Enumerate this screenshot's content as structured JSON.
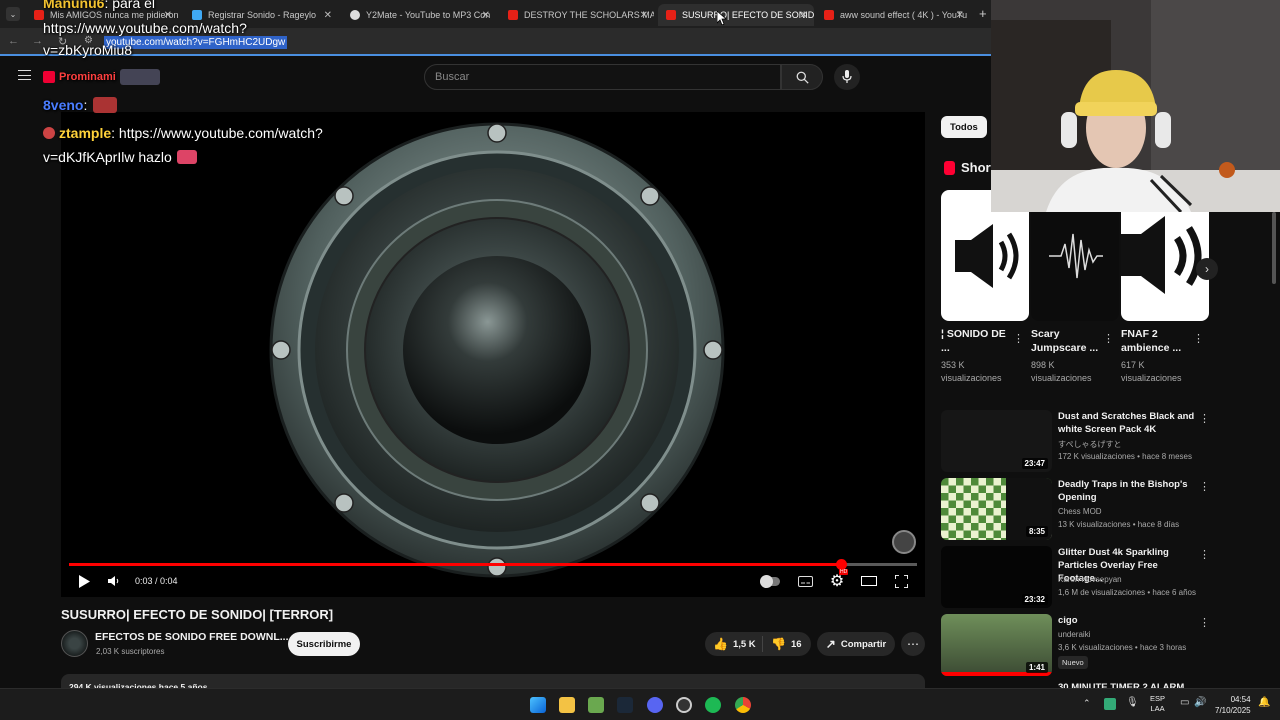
{
  "browser": {
    "tabs": [
      {
        "label": "Mis AMIGOS nunca me pidieron",
        "favicon": "#e62117",
        "active": false
      },
      {
        "label": "Registrar Sonido - Rageylo",
        "favicon": "#3fa9f5",
        "active": false
      },
      {
        "label": "Y2Mate - YouTube to MP3 Con",
        "favicon": "#dddddd",
        "active": false
      },
      {
        "label": "DESTROY THE SCHOLARS MA",
        "favicon": "#e62117",
        "active": false
      },
      {
        "label": "SUSURRO| EFECTO DE SONIDO",
        "favicon": "#e62117",
        "active": true
      },
      {
        "label": "aww sound effect ( 4K ) - YouTu",
        "favicon": "#e62117",
        "active": false
      }
    ],
    "url": "youtube.com/watch?v=FGHmHC2UDgw"
  },
  "youtube": {
    "search_placeholder": "Buscar",
    "player": {
      "time": "0:03 / 0:04",
      "progress": 0.91
    },
    "video_title": "SUSURRO| EFECTO DE SONIDO| [TERROR]",
    "channel": {
      "name": "EFECTOS DE SONIDO FREE DOWNL...",
      "subs": "2,03 K suscriptores"
    },
    "subscribe_label": "Suscribirme",
    "likes": "1,5 K",
    "dislikes": "16",
    "share_label": "Compartir",
    "description_stats": "294 K visualizaciones  hace 5 años",
    "chip_label": "Todos",
    "shorts_heading": "Shorts",
    "shorts": [
      {
        "title": "¦ SONIDO DE ...",
        "views": "353 K visualizaciones"
      },
      {
        "title": "Scary Jumpscare ...",
        "views": "898 K visualizaciones"
      },
      {
        "title": "FNAF 2 ambience ...",
        "views": "617 K visualizaciones"
      }
    ],
    "recommended": [
      {
        "title": "Dust and Scratches Black and white Screen Pack 4K",
        "channel": "すぺしゃるげすと",
        "meta": "172 K visualizaciones • hace 8 meses",
        "duration": "23:47"
      },
      {
        "title": "Deadly Traps in the Bishop's Opening",
        "channel": "Chess MOD",
        "meta": "13 K visualizaciones • hace 8 días",
        "duration": "8:35"
      },
      {
        "title": "Glitter Dust 4k Sparkling Particles Overlay Free Footage...",
        "channel": "Karen Hovsepyan",
        "meta": "1,6 M de visualizaciones • hace 6 años",
        "duration": "23:32"
      },
      {
        "title": "cigo",
        "channel": "underaiki",
        "meta": "3,6 K visualizaciones • hace 3 horas",
        "duration": "1:41",
        "badge": "Nuevo"
      }
    ],
    "rec_partial": "30 MINUTE TIMER 2 ALARM"
  },
  "chat": {
    "lines": [
      {
        "user": "Manunu6",
        "text": "para el",
        "color": "#f2c230"
      },
      {
        "user": "",
        "text": "https://www.youtube.com/watch?",
        "color": "#ffffff"
      },
      {
        "user": "",
        "text": "v=zbKyroMiu8",
        "color": "#ffffff"
      },
      {
        "user": "Prominami",
        "text": "",
        "color": "#ff4040"
      },
      {
        "user": "8veno",
        "text": ":",
        "color": "#4a7dff"
      },
      {
        "user": "ztample",
        "text": ": https://www.youtube.com/watch?",
        "color": "#ffd23a"
      },
      {
        "user": "",
        "text": "v=dKJfKAprIlw hazlo",
        "color": "#ffffff"
      }
    ]
  },
  "taskbar": {
    "lang_1": "ESP",
    "lang_2": "LAA",
    "time": "04:54",
    "date": "7/10/2025"
  }
}
